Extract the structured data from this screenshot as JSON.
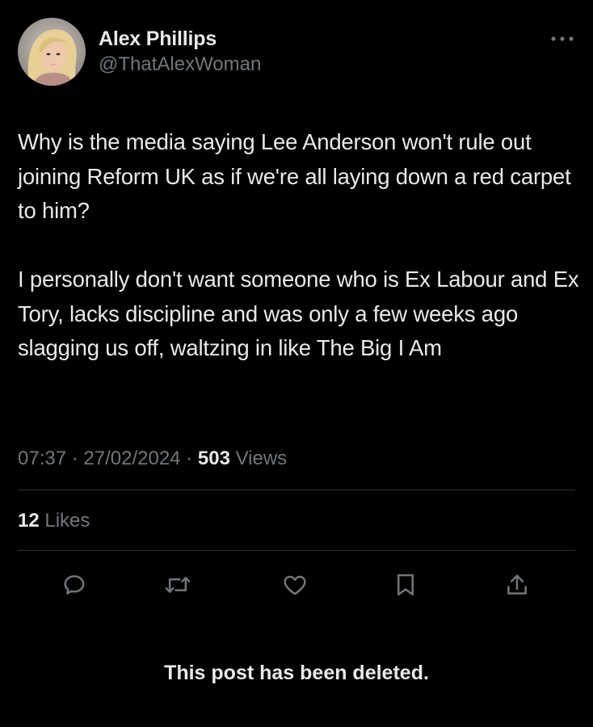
{
  "author": {
    "display_name": "Alex Phillips",
    "handle": "@ThatAlexWoman",
    "avatar_icon": "profile-photo"
  },
  "post": {
    "text": "Why is the media saying Lee Anderson won't rule out joining Reform UK as if we're all laying down a red carpet to him?\n\nI personally don't want someone who is Ex Labour and Ex Tory, lacks discipline and was only a few weeks ago slagging us off, waltzing in like The Big I Am",
    "time": "07:37",
    "date": "27/02/2024",
    "separator": "·",
    "views_count": "503",
    "views_label": "Views",
    "likes_count": "12",
    "likes_label": "Likes"
  },
  "actions": [
    {
      "name": "reply",
      "icon": "speech-bubble-icon"
    },
    {
      "name": "repost",
      "icon": "repost-arrows-icon"
    },
    {
      "name": "like",
      "icon": "heart-icon"
    },
    {
      "name": "bookmark",
      "icon": "bookmark-icon"
    },
    {
      "name": "share",
      "icon": "share-upload-icon"
    }
  ],
  "notice": "This post has been deleted.",
  "colors": {
    "background": "#000000",
    "primary_text": "#e7e9ea",
    "secondary_text": "#71767b",
    "divider": "#2f3336",
    "icon": "#71767b"
  }
}
